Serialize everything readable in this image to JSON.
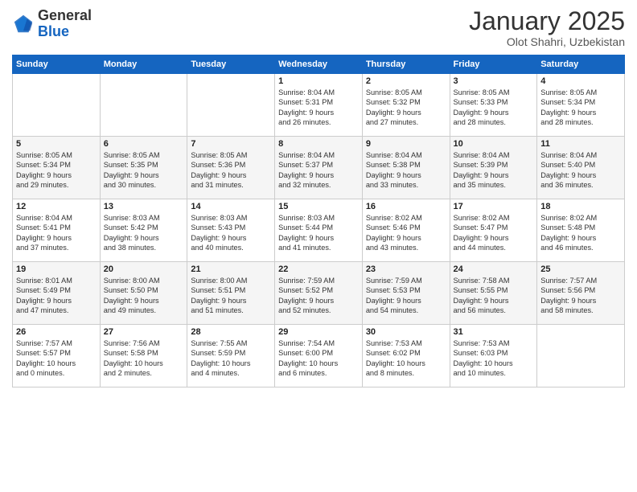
{
  "logo": {
    "general": "General",
    "blue": "Blue"
  },
  "header": {
    "month_year": "January 2025",
    "location": "Olot Shahri, Uzbekistan"
  },
  "weekdays": [
    "Sunday",
    "Monday",
    "Tuesday",
    "Wednesday",
    "Thursday",
    "Friday",
    "Saturday"
  ],
  "weeks": [
    [
      {
        "day": "",
        "info": ""
      },
      {
        "day": "",
        "info": ""
      },
      {
        "day": "",
        "info": ""
      },
      {
        "day": "1",
        "info": "Sunrise: 8:04 AM\nSunset: 5:31 PM\nDaylight: 9 hours\nand 26 minutes."
      },
      {
        "day": "2",
        "info": "Sunrise: 8:05 AM\nSunset: 5:32 PM\nDaylight: 9 hours\nand 27 minutes."
      },
      {
        "day": "3",
        "info": "Sunrise: 8:05 AM\nSunset: 5:33 PM\nDaylight: 9 hours\nand 28 minutes."
      },
      {
        "day": "4",
        "info": "Sunrise: 8:05 AM\nSunset: 5:34 PM\nDaylight: 9 hours\nand 28 minutes."
      }
    ],
    [
      {
        "day": "5",
        "info": "Sunrise: 8:05 AM\nSunset: 5:34 PM\nDaylight: 9 hours\nand 29 minutes."
      },
      {
        "day": "6",
        "info": "Sunrise: 8:05 AM\nSunset: 5:35 PM\nDaylight: 9 hours\nand 30 minutes."
      },
      {
        "day": "7",
        "info": "Sunrise: 8:05 AM\nSunset: 5:36 PM\nDaylight: 9 hours\nand 31 minutes."
      },
      {
        "day": "8",
        "info": "Sunrise: 8:04 AM\nSunset: 5:37 PM\nDaylight: 9 hours\nand 32 minutes."
      },
      {
        "day": "9",
        "info": "Sunrise: 8:04 AM\nSunset: 5:38 PM\nDaylight: 9 hours\nand 33 minutes."
      },
      {
        "day": "10",
        "info": "Sunrise: 8:04 AM\nSunset: 5:39 PM\nDaylight: 9 hours\nand 35 minutes."
      },
      {
        "day": "11",
        "info": "Sunrise: 8:04 AM\nSunset: 5:40 PM\nDaylight: 9 hours\nand 36 minutes."
      }
    ],
    [
      {
        "day": "12",
        "info": "Sunrise: 8:04 AM\nSunset: 5:41 PM\nDaylight: 9 hours\nand 37 minutes."
      },
      {
        "day": "13",
        "info": "Sunrise: 8:03 AM\nSunset: 5:42 PM\nDaylight: 9 hours\nand 38 minutes."
      },
      {
        "day": "14",
        "info": "Sunrise: 8:03 AM\nSunset: 5:43 PM\nDaylight: 9 hours\nand 40 minutes."
      },
      {
        "day": "15",
        "info": "Sunrise: 8:03 AM\nSunset: 5:44 PM\nDaylight: 9 hours\nand 41 minutes."
      },
      {
        "day": "16",
        "info": "Sunrise: 8:02 AM\nSunset: 5:46 PM\nDaylight: 9 hours\nand 43 minutes."
      },
      {
        "day": "17",
        "info": "Sunrise: 8:02 AM\nSunset: 5:47 PM\nDaylight: 9 hours\nand 44 minutes."
      },
      {
        "day": "18",
        "info": "Sunrise: 8:02 AM\nSunset: 5:48 PM\nDaylight: 9 hours\nand 46 minutes."
      }
    ],
    [
      {
        "day": "19",
        "info": "Sunrise: 8:01 AM\nSunset: 5:49 PM\nDaylight: 9 hours\nand 47 minutes."
      },
      {
        "day": "20",
        "info": "Sunrise: 8:00 AM\nSunset: 5:50 PM\nDaylight: 9 hours\nand 49 minutes."
      },
      {
        "day": "21",
        "info": "Sunrise: 8:00 AM\nSunset: 5:51 PM\nDaylight: 9 hours\nand 51 minutes."
      },
      {
        "day": "22",
        "info": "Sunrise: 7:59 AM\nSunset: 5:52 PM\nDaylight: 9 hours\nand 52 minutes."
      },
      {
        "day": "23",
        "info": "Sunrise: 7:59 AM\nSunset: 5:53 PM\nDaylight: 9 hours\nand 54 minutes."
      },
      {
        "day": "24",
        "info": "Sunrise: 7:58 AM\nSunset: 5:55 PM\nDaylight: 9 hours\nand 56 minutes."
      },
      {
        "day": "25",
        "info": "Sunrise: 7:57 AM\nSunset: 5:56 PM\nDaylight: 9 hours\nand 58 minutes."
      }
    ],
    [
      {
        "day": "26",
        "info": "Sunrise: 7:57 AM\nSunset: 5:57 PM\nDaylight: 10 hours\nand 0 minutes."
      },
      {
        "day": "27",
        "info": "Sunrise: 7:56 AM\nSunset: 5:58 PM\nDaylight: 10 hours\nand 2 minutes."
      },
      {
        "day": "28",
        "info": "Sunrise: 7:55 AM\nSunset: 5:59 PM\nDaylight: 10 hours\nand 4 minutes."
      },
      {
        "day": "29",
        "info": "Sunrise: 7:54 AM\nSunset: 6:00 PM\nDaylight: 10 hours\nand 6 minutes."
      },
      {
        "day": "30",
        "info": "Sunrise: 7:53 AM\nSunset: 6:02 PM\nDaylight: 10 hours\nand 8 minutes."
      },
      {
        "day": "31",
        "info": "Sunrise: 7:53 AM\nSunset: 6:03 PM\nDaylight: 10 hours\nand 10 minutes."
      },
      {
        "day": "",
        "info": ""
      }
    ]
  ]
}
